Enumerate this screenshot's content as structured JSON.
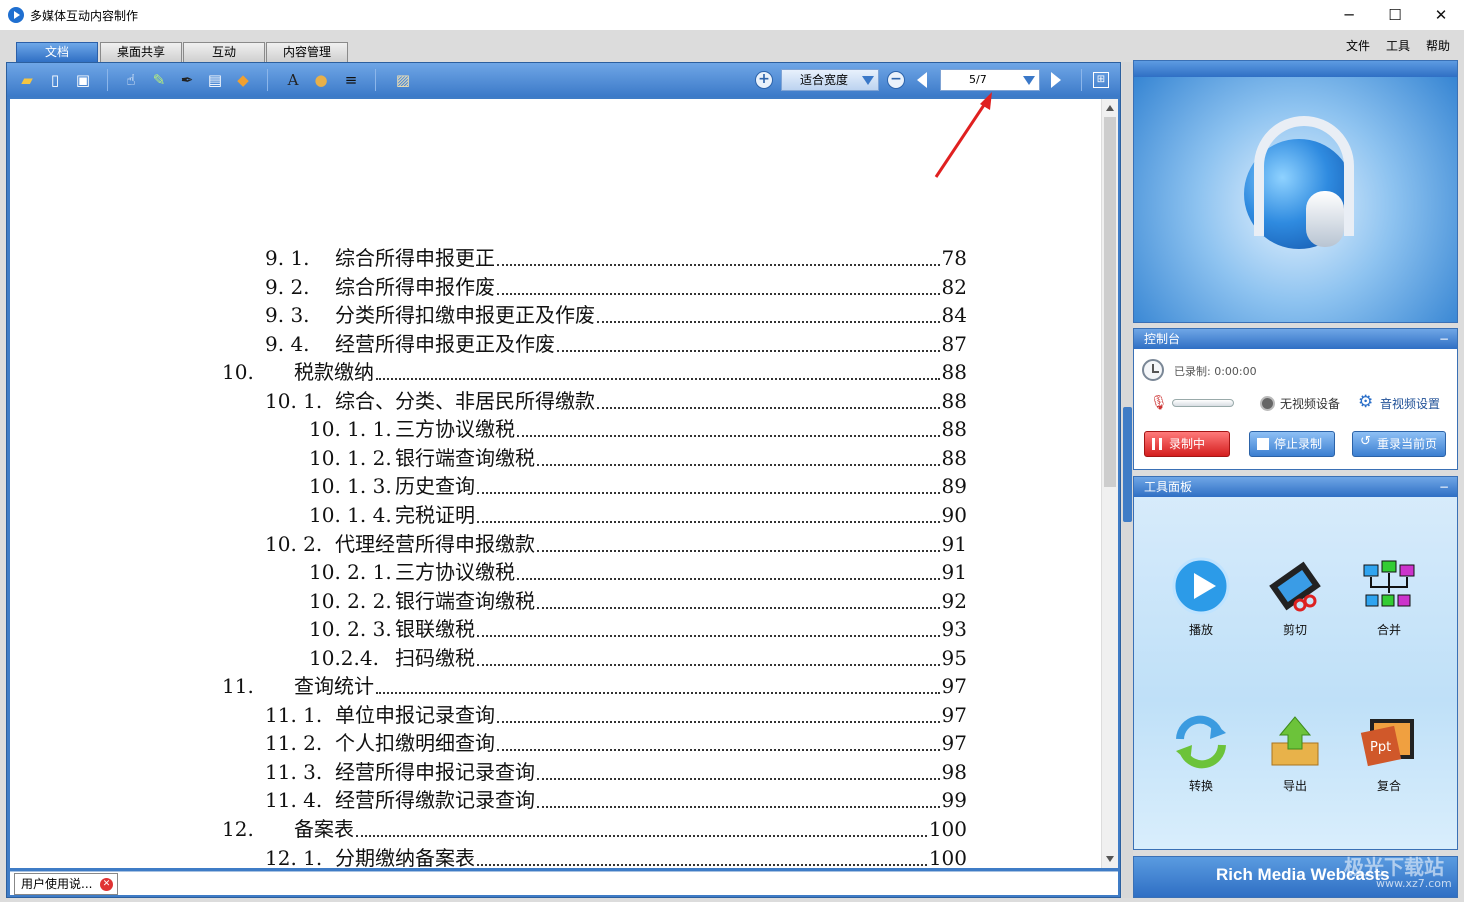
{
  "window": {
    "title": "多媒体互动内容制作",
    "minimize": "─",
    "maximize": "☐",
    "close": "✕"
  },
  "tabs": [
    {
      "label": "文档"
    },
    {
      "label": "桌面共享"
    },
    {
      "label": "互动"
    },
    {
      "label": "内容管理"
    }
  ],
  "menu": [
    {
      "label": "文件"
    },
    {
      "label": "工具"
    },
    {
      "label": "帮助"
    }
  ],
  "toolbar": {
    "zoom_label": "适合宽度",
    "page_indicator": "5/7",
    "icons": [
      "open-folder-icon",
      "new-page-icon",
      "screen-capture-icon",
      "hand-tool-icon",
      "highlighter-icon",
      "pen-icon",
      "text-box-icon",
      "eraser-icon",
      "font-icon",
      "palette-icon",
      "line-width-icon",
      "insert-text-icon",
      "zoom-in-icon",
      "zoom-out-icon",
      "prev-page-icon",
      "next-page-icon",
      "fullscreen-icon"
    ]
  },
  "toc": [
    {
      "num": "9. 1.",
      "title": "综合所得申报更正",
      "page": "78",
      "level": 2
    },
    {
      "num": "9. 2.",
      "title": "综合所得申报作废",
      "page": "82",
      "level": 2
    },
    {
      "num": "9. 3.",
      "title": "分类所得扣缴申报更正及作废",
      "page": "84",
      "level": 2
    },
    {
      "num": "9. 4.",
      "title": "经营所得申报更正及作废",
      "page": "87",
      "level": 2
    },
    {
      "num": "10.",
      "title": "税款缴纳",
      "page": "88",
      "level": 1
    },
    {
      "num": "10. 1.",
      "title": "综合、分类、非居民所得缴款",
      "page": "88",
      "level": 2
    },
    {
      "num": "10. 1. 1.",
      "title": "三方协议缴税",
      "page": "88",
      "level": 3
    },
    {
      "num": "10. 1. 2.",
      "title": "银行端查询缴税",
      "page": "88",
      "level": 3
    },
    {
      "num": "10. 1. 3.",
      "title": "历史查询",
      "page": "89",
      "level": 3
    },
    {
      "num": "10. 1. 4.",
      "title": "完税证明",
      "page": "90",
      "level": 3
    },
    {
      "num": "10. 2.",
      "title": "代理经营所得申报缴款",
      "page": "91",
      "level": 2
    },
    {
      "num": "10. 2. 1.",
      "title": "三方协议缴税",
      "page": "91",
      "level": 3
    },
    {
      "num": "10. 2. 2.",
      "title": "银行端查询缴税",
      "page": "92",
      "level": 3
    },
    {
      "num": "10. 2. 3.",
      "title": "银联缴税",
      "page": "93",
      "level": 3
    },
    {
      "num": "10.2.4.",
      "title": "扫码缴税",
      "page": "95",
      "level": 3
    },
    {
      "num": "11.",
      "title": "查询统计",
      "page": "97",
      "level": 1
    },
    {
      "num": "11. 1.",
      "title": "单位申报记录查询",
      "page": "97",
      "level": 2
    },
    {
      "num": "11. 2.",
      "title": "个人扣缴明细查询",
      "page": "97",
      "level": 2
    },
    {
      "num": "11. 3.",
      "title": "经营所得申报记录查询",
      "page": "98",
      "level": 2
    },
    {
      "num": "11. 4.",
      "title": "经营所得缴款记录查询",
      "page": "99",
      "level": 2
    },
    {
      "num": "12.",
      "title": "备案表",
      "page": "100",
      "level": 1
    },
    {
      "num": "12. 1.",
      "title": "分期缴纳备案表",
      "page": "100",
      "level": 2
    }
  ],
  "doc_tab": {
    "label": "用户使用说..."
  },
  "control_panel": {
    "title": "控制台",
    "recorded": "已录制: 0:00:00",
    "no_video": "无视频设备",
    "av_settings": "音视频设置",
    "btn_recording": "录制中",
    "btn_stop": "停止录制",
    "btn_rerecord": "重录当前页"
  },
  "tools_panel": {
    "title": "工具面板",
    "tools": [
      {
        "label": "播放",
        "icon": "play-icon"
      },
      {
        "label": "剪切",
        "icon": "film-cut-icon"
      },
      {
        "label": "合并",
        "icon": "merge-icon"
      },
      {
        "label": "转换",
        "icon": "convert-icon"
      },
      {
        "label": "导出",
        "icon": "export-icon"
      },
      {
        "label": "复合",
        "icon": "ppt-composite-icon"
      }
    ]
  },
  "brand": {
    "text": "Rich Media Webcasts",
    "watermark": "极光下载站",
    "watermark_url": "www.xz7.com"
  }
}
